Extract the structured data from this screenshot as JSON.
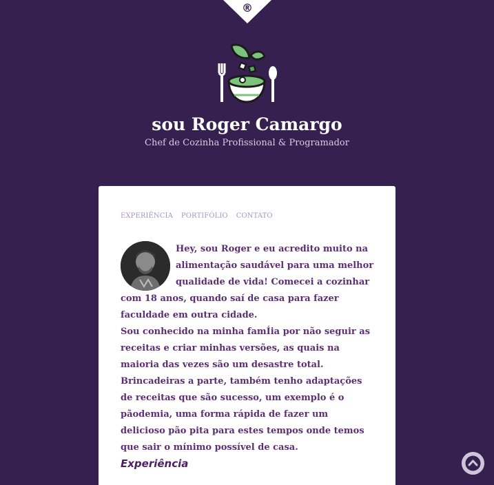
{
  "header": {
    "reg_mark": "®",
    "title": "sou Roger Camargo",
    "subtitle": "Chef de Cozinha Profissional & Programador"
  },
  "nav": {
    "items": [
      {
        "label": "EXPERIÊNCIA"
      },
      {
        "label": "PORTIFÓLIO"
      },
      {
        "label": "CONTATO"
      }
    ]
  },
  "about": {
    "paragraphs": [
      "Hey, sou Roger e eu acredito muito na alimentação saudável para uma melhor qualidade de vida! Comecei a cozinhar com 18 anos, quando saí de casa para fazer faculdade em outra cidade.",
      "Sou conhecido na minha famÍia por não seguir as receitas e criar minhas versões, as quais na maioria das vezes são um desastre total.",
      "Brincadeiras a parte, também tenho adaptações de receitas que são sucesso, um exemplo é o pãodemia, uma forma rápida de fazer um delicioso pão pita para estes tempos onde temos que sair o mínimo possível de casa."
    ]
  },
  "sections": {
    "experience_title": "Experiência"
  },
  "icons": {
    "logo": "salad-bowl-cutlery-icon",
    "avatar": "chef-portrait",
    "scroll_top": "chevron-up-icon"
  },
  "colors": {
    "background": "#36204f",
    "card": "#ffffff",
    "text": "#5b2f72",
    "nav": "#a796b9",
    "accent_green": "#7cc47e",
    "scroll_button": "#cfc5da"
  }
}
